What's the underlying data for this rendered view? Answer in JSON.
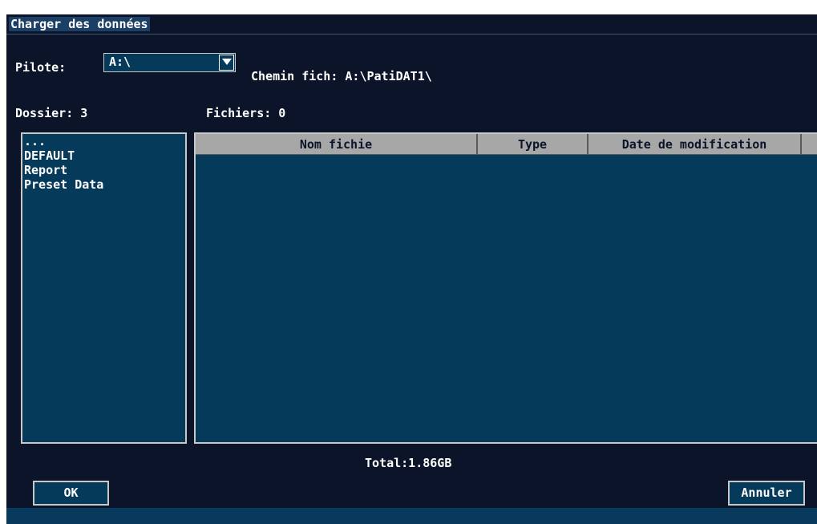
{
  "window": {
    "title": "Charger des données"
  },
  "drive": {
    "label": "Pilote:",
    "value": "A:\\",
    "path_text": "Chemin fich: A:\\PatiDAT1\\"
  },
  "counts": {
    "folders": "Dossier: 3",
    "files": "Fichiers: 0"
  },
  "folder_list": {
    "items": [
      {
        "label": "..."
      },
      {
        "label": "DEFAULT"
      },
      {
        "label": "Report"
      },
      {
        "label": "Preset Data"
      }
    ]
  },
  "file_table": {
    "columns": [
      "Nom fichie",
      "Type",
      "Date de modification",
      ""
    ],
    "rows": []
  },
  "total": "Total:1.86GB",
  "buttons": {
    "ok": "OK",
    "cancel": "Annuler"
  },
  "colors": {
    "dialog_bg": "#0b1428",
    "panel_bg": "#063a5a",
    "header_bg": "#a7a7a7",
    "title_highlight": "#1c3f66",
    "text": "#ffffff"
  },
  "icons": {
    "dropdown": "chevron-down-icon"
  }
}
